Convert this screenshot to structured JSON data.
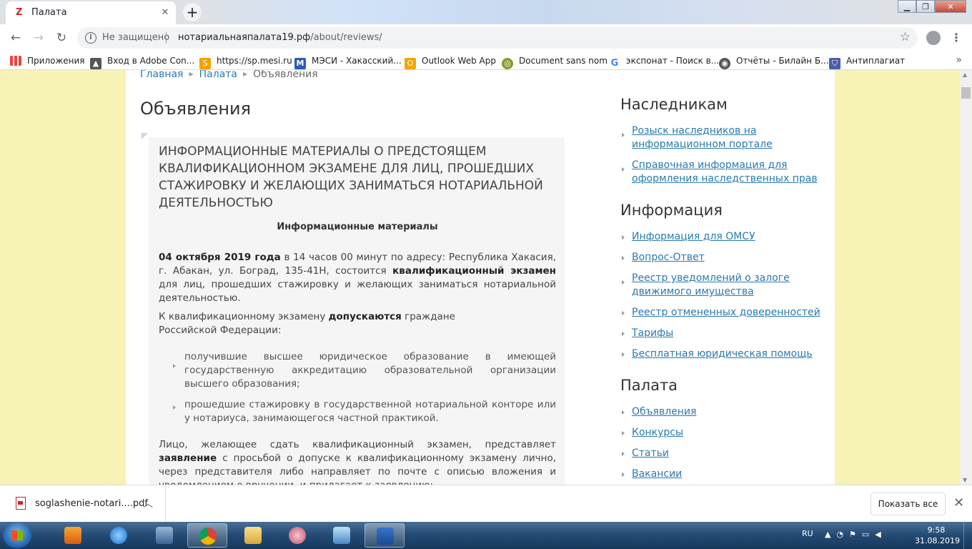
{
  "browser": {
    "tab_title": "Палата",
    "url_insecure": "Не защищено",
    "url_host": "нотариальнаяпалата19.рф",
    "url_path": "/about/reviews/",
    "bookmarks": [
      "Приложения",
      "Вход в Adobe Con...",
      "https://sp.mesi.ru",
      "МЭСИ - Хакасский...",
      "Outlook Web App",
      "Document sans nom",
      "экспонат - Поиск в...",
      "Отчёты - Билайн Б...",
      "Антиплагиат"
    ]
  },
  "breadcrumb": [
    "Главная",
    "Палата",
    "Объявления"
  ],
  "page_title": "Объявления",
  "article": {
    "title": "ИНФОРМАЦИОННЫЕ МАТЕРИАЛЫ О ПРЕДСТОЯЩЕМ КВАЛИФИКАЦИОННОМ ЭКЗАМЕНЕ ДЛЯ ЛИЦ, ПРОШЕДШИХ СТАЖИРОВКУ И ЖЕЛАЮЩИХ ЗАНИМАТЬСЯ НОТАРИАЛЬНОЙ ДЕЯТЕЛЬНОСТЬЮ",
    "subtitle": "Информационные материалы",
    "p1_date": "04 октября 2019 года",
    "p1_a": " в 14 часов 00 минут по адресу: Республика Хакасия, г. Абакан, ул. Боград, 135-41Н, состоится ",
    "p1_exam": "квалификационный экзамен",
    "p1_b": " для лиц, прошедших стажировку и желающих заниматься нотариальной деятельностью.",
    "p2_a": "К квалификационному экзамену ",
    "p2_bold": "допускаются",
    "p2_b": " граждане Российской Федерации:",
    "list": [
      "получившие высшее юридическое образование в имеющей государственную аккредитацию образовательной организации высшего образования;",
      "прошедшие стажировку в государственной нотариальной конторе или у нотариуса, занимающегося частной практикой."
    ],
    "p3_a": "Лицо, желающее сдать квалификационный экзамен, представляет ",
    "p3_bold": "заявление",
    "p3_b": " с просьбой о допуске к квалификационному экзамену лично, через представителя либо направляет по почте с описью вложения и уведомлением о вручении, и прилагает к заявлению:"
  },
  "sidebar": {
    "heirs_title": "Наследникам",
    "heirs": [
      "Розыск наследников на информационном портале",
      "Справочная информация для оформления наследственных прав"
    ],
    "info_title": "Информация",
    "info": [
      "Информация для ОМСУ",
      "Вопрос-Ответ",
      "Реестр уведомлений о залоге движимого имущества",
      "Реестр отмененных доверенностей",
      "Тарифы",
      "Бесплатная юридическая помощь"
    ],
    "chamber_title": "Палата",
    "chamber": [
      "Объявления",
      "Конкурсы",
      "Статьи",
      "Вакансии"
    ]
  },
  "download": {
    "file": "soglashenie-notari....pdf",
    "show_all": "Показать все"
  },
  "taskbar": {
    "lang": "RU",
    "time": "9:58",
    "date": "31.08.2019"
  }
}
